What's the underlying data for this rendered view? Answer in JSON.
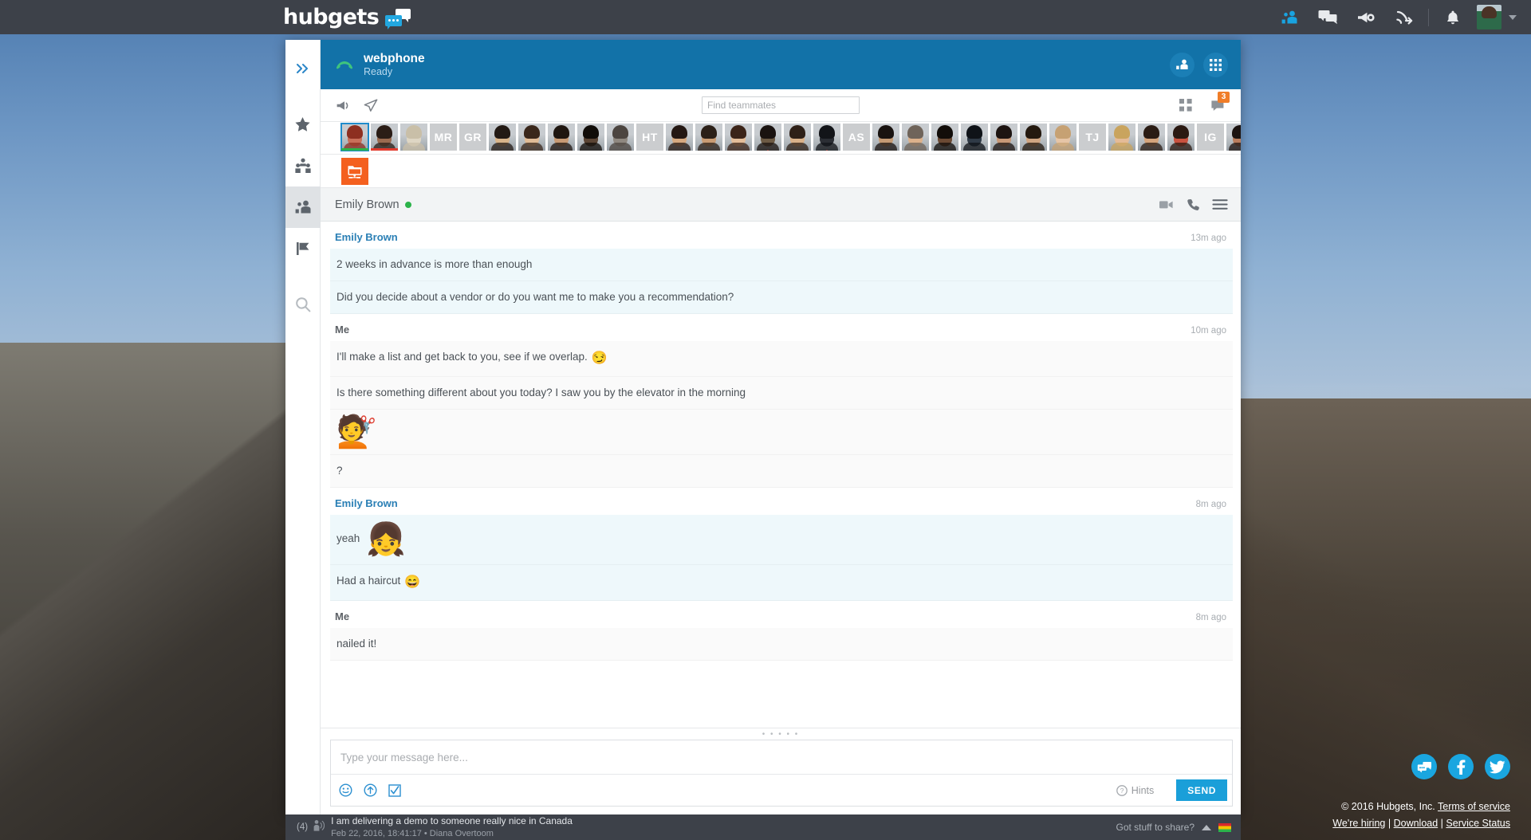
{
  "brand": {
    "wordmark": "hubgets"
  },
  "topbar": {
    "icons": [
      {
        "name": "teammates-icon",
        "label": "Teammates",
        "active": true
      },
      {
        "name": "chat-icon",
        "label": "Chat"
      },
      {
        "name": "megaphone-icon",
        "label": "Announcements"
      },
      {
        "name": "call-forward-icon",
        "label": "Calls"
      },
      {
        "name": "bell-icon",
        "label": "Notifications"
      }
    ],
    "avatar_label": "Diana Overtoom",
    "caret_label": "Open account menu"
  },
  "rail": {
    "items": [
      {
        "name": "expand-icon",
        "label": "Expand",
        "active": false
      },
      {
        "name": "star-icon",
        "label": "Favorites",
        "active": false
      },
      {
        "name": "colleagues-icon",
        "label": "Colleagues",
        "active": false
      },
      {
        "name": "teammates-icon",
        "label": "Teammates",
        "active": true
      },
      {
        "name": "flag-icon",
        "label": "Flagged",
        "active": false
      },
      {
        "name": "search-icon",
        "label": "Search",
        "active": false
      }
    ]
  },
  "phone": {
    "name": "webphone",
    "status": "Ready",
    "status_icon": "handset-icon",
    "actions": [
      {
        "name": "contacts-button",
        "label": "Contacts"
      },
      {
        "name": "dialpad-button",
        "label": "Dialpad"
      }
    ]
  },
  "toolbar": {
    "megaphone_label": "Broadcast",
    "send_label": "Send",
    "grid_label": "Grid view",
    "chat_label": "Conversations",
    "badge": "3"
  },
  "search": {
    "placeholder": "Find teammates",
    "value": ""
  },
  "teammates": [
    {
      "type": "photo",
      "tone": "#c9705a",
      "hair": "#8d2f20",
      "selected": true,
      "status": "green"
    },
    {
      "type": "photo",
      "tone": "#9b6b50",
      "hair": "#2b1d16",
      "status": "red"
    },
    {
      "type": "photo",
      "tone": "#ded6c4",
      "hair": "#c9bfa8"
    },
    {
      "type": "initials",
      "label": "MR"
    },
    {
      "type": "initials",
      "label": "GR"
    },
    {
      "type": "photo",
      "tone": "#d8b48a",
      "hair": "#231a14"
    },
    {
      "type": "photo",
      "tone": "#e0bb96",
      "hair": "#3a271b"
    },
    {
      "type": "photo",
      "tone": "#c79a74",
      "hair": "#1f1610"
    },
    {
      "type": "photo",
      "tone": "#5a4434",
      "hair": "#100c08"
    },
    {
      "type": "photo",
      "tone": "#8f8880",
      "hair": "#4c4540"
    },
    {
      "type": "initials",
      "label": "HT"
    },
    {
      "type": "photo",
      "tone": "#d5a87f",
      "hair": "#241813"
    },
    {
      "type": "photo",
      "tone": "#c89b73",
      "hair": "#2b2018"
    },
    {
      "type": "photo",
      "tone": "#e3bd99",
      "hair": "#3b2418"
    },
    {
      "type": "photo",
      "tone": "#6c5a44",
      "hair": "#1a1310",
      "status": "triangle-red"
    },
    {
      "type": "photo",
      "tone": "#d9b189",
      "hair": "#2e2017"
    },
    {
      "type": "photo",
      "tone": "#2b2e34",
      "hair": "#121418",
      "status": "triangle-red"
    },
    {
      "type": "initials",
      "label": "AS"
    },
    {
      "type": "photo",
      "tone": "#c49a74",
      "hair": "#191310"
    },
    {
      "type": "photo",
      "tone": "#dcb18b",
      "hair": "#6f645a"
    },
    {
      "type": "photo",
      "tone": "#6b4a34",
      "hair": "#120d09"
    },
    {
      "type": "photo",
      "tone": "#2f3a46",
      "hair": "#0f1318"
    },
    {
      "type": "photo",
      "tone": "#c89877",
      "hair": "#1d1411"
    },
    {
      "type": "photo",
      "tone": "#cfa582",
      "hair": "#24190f"
    },
    {
      "type": "photo",
      "tone": "#e6c5a6",
      "hair": "#c6a173"
    },
    {
      "type": "initials",
      "label": "TJ"
    },
    {
      "type": "photo",
      "tone": "#e4bb97",
      "hair": "#c9a45e"
    },
    {
      "type": "photo",
      "tone": "#d4a47c",
      "hair": "#2a1c14"
    },
    {
      "type": "photo",
      "tone": "#c9523f",
      "hair": "#2a1912"
    },
    {
      "type": "initials",
      "label": "IG"
    },
    {
      "type": "photo",
      "tone": "#b97c5c",
      "hair": "#1c1310"
    },
    {
      "type": "photo",
      "tone": "#d0a27d",
      "hair": "#221810"
    }
  ],
  "app_tile": {
    "name": "screen-share-icon",
    "label": "Screen share",
    "color": "#f4601f"
  },
  "conversation": {
    "name": "Emily Brown",
    "presence": "online",
    "actions": [
      {
        "name": "video-call-icon",
        "label": "Video call"
      },
      {
        "name": "voice-call-icon",
        "label": "Voice call"
      },
      {
        "name": "menu-icon",
        "label": "More options"
      }
    ]
  },
  "messages": [
    {
      "author": "Emily Brown",
      "side": "them",
      "time": "13m ago",
      "lines": [
        {
          "text": "2 weeks in advance is more than enough"
        },
        {
          "text": "Did you decide about a vendor or do you want me to make you a recommendation?"
        }
      ]
    },
    {
      "author": "Me",
      "side": "me",
      "time": "10m ago",
      "lines": [
        {
          "text": "I'll make a list and get back to you, see if we overlap.",
          "emoji": "😏"
        },
        {
          "text": "Is there something different about you today? I saw you by the elevator in the morning"
        },
        {
          "text": "",
          "big_emoji": "💇"
        },
        {
          "text": "?"
        }
      ]
    },
    {
      "author": "Emily Brown",
      "side": "them",
      "time": "8m ago",
      "lines": [
        {
          "text": "yeah",
          "big_emoji": "👧"
        },
        {
          "text": "Had a haircut",
          "emoji": "😄"
        }
      ]
    },
    {
      "author": "Me",
      "side": "me",
      "time": "8m ago",
      "lines": [
        {
          "text": "nailed it!"
        }
      ]
    }
  ],
  "composer": {
    "placeholder": "Type your message here...",
    "value": "",
    "emoji_label": "Insert emoji",
    "upload_label": "Upload file",
    "task_label": "Create task",
    "hints_label": "Hints",
    "send_label": "SEND",
    "send_color": "#1a9fd9"
  },
  "statusbar": {
    "count": "(4)",
    "icon": "speaking-person-icon",
    "title": "I am delivering a demo to someone really nice in Canada",
    "subtitle": "Feb 22, 2016, 18:41:17  •  Diana Overtoom",
    "share_label": "Got stuff to share?",
    "flag_label": "Status color"
  },
  "footer": {
    "social": [
      {
        "name": "hubgets-icon",
        "label": "Hubgets"
      },
      {
        "name": "facebook-icon",
        "label": "Facebook"
      },
      {
        "name": "twitter-icon",
        "label": "Twitter"
      }
    ],
    "copyright": "© 2016 Hubgets, Inc.",
    "terms": "Terms of service",
    "hiring": "We're hiring",
    "download": "Download",
    "status": "Service Status",
    "sep1": "|",
    "sep2": "|"
  }
}
